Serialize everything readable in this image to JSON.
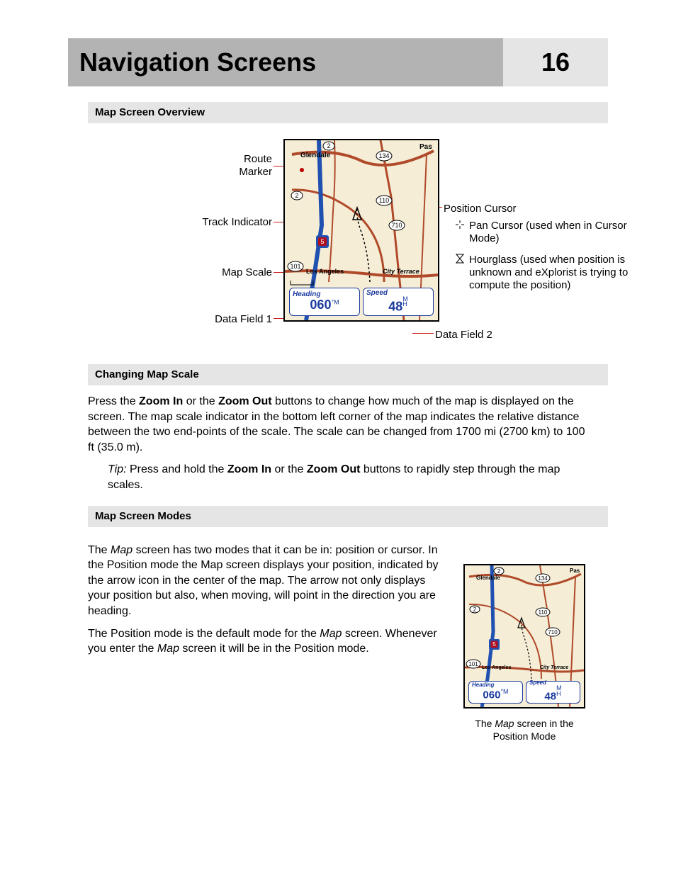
{
  "title": "Navigation Screens",
  "page_number": "16",
  "section1": {
    "heading": "Map Screen Overview"
  },
  "fig1": {
    "labels": {
      "route_marker": "Route\nMarker",
      "track_indicator": "Track Indicator",
      "map_scale": "Map Scale",
      "data_field_1": "Data Field 1",
      "data_field_2": "Data Field 2",
      "position_cursor": "Position Cursor",
      "pan_cursor": "Pan Cursor (used when in Cursor Mode)",
      "hourglass": "Hourglass (used when position is unknown and eXplorist is trying to compute the position)"
    },
    "map": {
      "places": {
        "glendale": "Glendale",
        "la": "Los Angeles",
        "city_terrace": "City Terrace",
        "pas": "Pas"
      },
      "routes": {
        "r2a": "2",
        "r2b": "2",
        "r134": "134",
        "r110": "110",
        "r710": "710",
        "r101": "101",
        "i5": "5"
      },
      "data": {
        "heading_label": "Heading",
        "heading_value": "060",
        "heading_unit": "°M",
        "speed_label": "Speed",
        "speed_value": "48",
        "speed_unit": "M\nH"
      }
    }
  },
  "section2": {
    "heading": "Changing Map Scale",
    "para1_pre": "Press the ",
    "zoom_in": "Zoom In",
    "para1_mid1": " or the ",
    "zoom_out": "Zoom Out",
    "para1_post": " buttons to change how much of the map is displayed on the screen.  The map scale indicator in the bottom left corner of the map indicates the relative distance between the two end-points of the scale.  The scale can be changed from 1700 mi (2700 km) to 100 ft (35.0 m).",
    "tip_label": "Tip:",
    "tip_pre": " Press and hold the ",
    "tip_mid": " or the ",
    "tip_post": " buttons to rapidly step through the map scales."
  },
  "section3": {
    "heading": "Map Screen Modes",
    "map_word": "Map",
    "para1_pre": "The ",
    "para1_post": " screen has two modes that it can be in: position or cursor.  In the Position mode the Map screen displays your position, indicated by the arrow icon in the center of the map.  The arrow not only displays your position but also, when moving, will point in the direction you are heading.",
    "para2_pre": "The Position mode is the default mode for the ",
    "para2_mid": " screen. Whenever you enter the ",
    "para2_post": " screen it will be in the Position mode.",
    "caption_pre": "The ",
    "caption_post": " screen in the Position Mode"
  }
}
